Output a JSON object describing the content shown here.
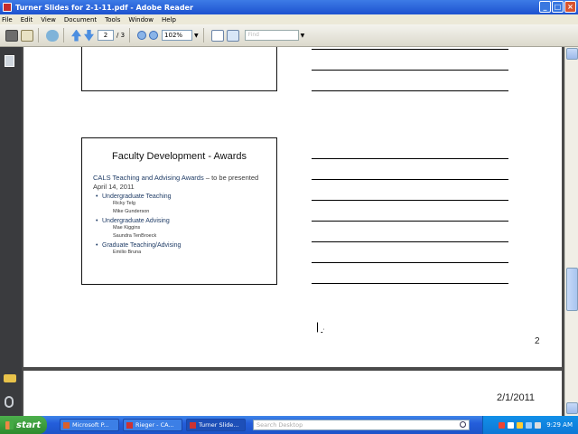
{
  "window": {
    "title": "Turner Slides for 2-1-11.pdf - Adobe Reader"
  },
  "menu": [
    "File",
    "Edit",
    "View",
    "Document",
    "Tools",
    "Window",
    "Help"
  ],
  "toolbar": {
    "page_current": "2",
    "page_total": "/ 3",
    "zoom": "102%",
    "find_placeholder": "Find"
  },
  "slide": {
    "title": "Faculty Development - Awards",
    "lead_bold": "CALS Teaching and Advising Awards",
    "lead_rest": " – to be presented April 14, 2011",
    "categories": [
      {
        "label": "Undergraduate Teaching",
        "names": [
          "Ricky Telg",
          "Mike Gunderson"
        ]
      },
      {
        "label": "Undergraduate Advising",
        "names": [
          "Mae Kiggins",
          "Saundra TenBroeck"
        ]
      },
      {
        "label": "Graduate Teaching/Advising",
        "names": [
          "Emilio Bruna"
        ]
      }
    ]
  },
  "page": {
    "number": "2",
    "date": "2/1/2011"
  },
  "taskbar": {
    "start": "start",
    "tasks": [
      "Microsoft P...",
      "Rieger - CA...",
      "Turner Slide..."
    ],
    "search_placeholder": "Search Desktop",
    "clock": "9:29 AM"
  },
  "colors": {
    "accent": "#245edb",
    "slide_text": "#1f3c66"
  }
}
